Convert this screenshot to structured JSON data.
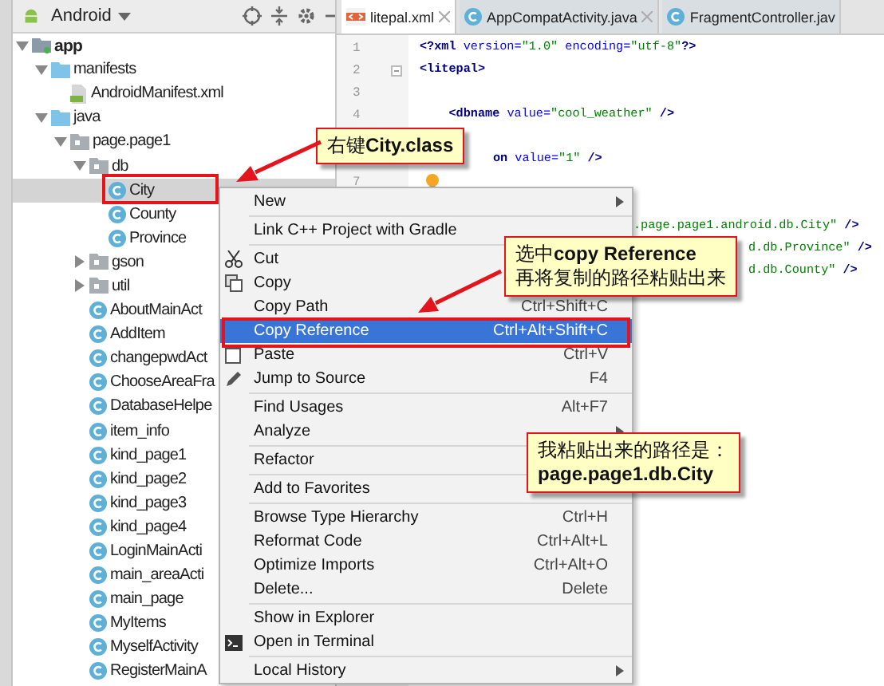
{
  "project_panel": {
    "view_selector": "Android",
    "tree": [
      {
        "label": "app",
        "kind": "module",
        "expanded": true,
        "selected": false,
        "children": [
          {
            "label": "manifests",
            "kind": "source_folder",
            "expanded": true,
            "selected": false,
            "children": [
              {
                "label": "AndroidManifest.xml",
                "kind": "manifest",
                "selected": false
              }
            ]
          },
          {
            "label": "java",
            "kind": "source_folder",
            "expanded": true,
            "selected": false,
            "children": [
              {
                "label": "page.page1",
                "kind": "package",
                "expanded": true,
                "selected": false,
                "children": [
                  {
                    "label": "db",
                    "kind": "package",
                    "expanded": true,
                    "selected": false,
                    "children": [
                      {
                        "label": "City",
                        "kind": "class",
                        "selected": true
                      },
                      {
                        "label": "County",
                        "kind": "class",
                        "selected": false
                      },
                      {
                        "label": "Province",
                        "kind": "class",
                        "selected": false
                      }
                    ]
                  },
                  {
                    "label": "gson",
                    "kind": "package",
                    "expanded": false,
                    "selected": false
                  },
                  {
                    "label": "util",
                    "kind": "package",
                    "expanded": false,
                    "selected": false
                  },
                  {
                    "label": "AboutMainAct",
                    "kind": "class",
                    "selected": false
                  },
                  {
                    "label": "AddItem",
                    "kind": "class",
                    "selected": false
                  },
                  {
                    "label": "changepwdAct",
                    "kind": "class",
                    "selected": false
                  },
                  {
                    "label": "ChooseAreaFra",
                    "kind": "class",
                    "selected": false
                  },
                  {
                    "label": "DatabaseHelpe",
                    "kind": "class",
                    "selected": false
                  },
                  {
                    "label": "item_info",
                    "kind": "class",
                    "selected": false
                  },
                  {
                    "label": "kind_page1",
                    "kind": "class",
                    "selected": false
                  },
                  {
                    "label": "kind_page2",
                    "kind": "class",
                    "selected": false
                  },
                  {
                    "label": "kind_page3",
                    "kind": "class",
                    "selected": false
                  },
                  {
                    "label": "kind_page4",
                    "kind": "class",
                    "selected": false
                  },
                  {
                    "label": "LoginMainActi",
                    "kind": "class",
                    "selected": false
                  },
                  {
                    "label": "main_areaActi",
                    "kind": "class",
                    "selected": false
                  },
                  {
                    "label": "main_page",
                    "kind": "class",
                    "selected": false
                  },
                  {
                    "label": "MyItems",
                    "kind": "class",
                    "selected": false
                  },
                  {
                    "label": "MyselfActivity",
                    "kind": "class",
                    "selected": false
                  },
                  {
                    "label": "RegisterMainA",
                    "kind": "class",
                    "selected": false
                  }
                ]
              }
            ]
          }
        ]
      }
    ]
  },
  "editor": {
    "tabs": [
      {
        "label": "litepal.xml",
        "kind": "xml",
        "selected": true,
        "closable": true
      },
      {
        "label": "AppCompatActivity.java",
        "kind": "class",
        "selected": false,
        "closable": true
      },
      {
        "label": "FragmentController.jav",
        "kind": "class",
        "selected": false,
        "closable": false
      }
    ],
    "lines": [
      {
        "kind": "code",
        "number": "1",
        "tokens": [
          {
            "text": "<?xml ",
            "kind": "tag"
          },
          {
            "text": "version=",
            "kind": "attr"
          },
          {
            "text": "\"1.0\" ",
            "kind": "value"
          },
          {
            "text": "encoding=",
            "kind": "attr"
          },
          {
            "text": "\"utf-8\"",
            "kind": "value"
          },
          {
            "text": "?>",
            "kind": "tag"
          }
        ]
      },
      {
        "kind": "code",
        "number": "2",
        "fold": true,
        "tokens": [
          {
            "text": "<litepal>",
            "kind": "tag"
          }
        ]
      },
      {
        "kind": "code",
        "number": "3"
      },
      {
        "kind": "code",
        "number": "4",
        "tokens": [
          {
            "text": "    <dbname ",
            "kind": "tag"
          },
          {
            "text": "value=",
            "kind": "attr"
          },
          {
            "text": "\"cool_weather\"",
            "kind": "value"
          },
          {
            "text": " />",
            "kind": "tag"
          }
        ]
      },
      {
        "kind": "hidden"
      },
      {
        "kind": "covered",
        "tokens": [
          {
            "text": "on ",
            "kind": "tag"
          },
          {
            "text": "value=",
            "kind": "attr"
          },
          {
            "text": "\"1\"",
            "kind": "value"
          },
          {
            "text": " />",
            "kind": "tag"
          }
        ]
      },
      {
        "kind": "code",
        "number": "7",
        "bulb": true
      },
      {
        "kind": "hidden"
      },
      {
        "kind": "tail",
        "tokens": [
          {
            "text": ".page.page1.android.db.City\"",
            "kind": "value"
          },
          {
            "text": " />",
            "kind": "tag"
          }
        ]
      },
      {
        "kind": "far_tail",
        "tokens": [
          {
            "text": "d.db.Province\"",
            "kind": "value"
          },
          {
            "text": " />",
            "kind": "tag"
          }
        ]
      },
      {
        "kind": "far_tail",
        "tokens": [
          {
            "text": "d.db.County\"",
            "kind": "value"
          },
          {
            "text": " />",
            "kind": "tag"
          }
        ]
      }
    ]
  },
  "context_menu": {
    "items": [
      {
        "label": "New",
        "submenu": true,
        "selected": false,
        "separator_after": true
      },
      {
        "label": "Link C++ Project with Gradle",
        "selected": false,
        "separator_after": true
      },
      {
        "label": "Cut",
        "selected": false
      },
      {
        "label": "Copy",
        "selected": false
      },
      {
        "label": "Copy Path",
        "shortcut": "Ctrl+Shift+C",
        "selected": false
      },
      {
        "label": "Copy Reference",
        "shortcut": "Ctrl+Alt+Shift+C",
        "selected": true
      },
      {
        "label": "Paste",
        "shortcut": "Ctrl+V",
        "selected": false
      },
      {
        "label": "Jump to Source",
        "shortcut": "F4",
        "selected": false,
        "separator_after": true
      },
      {
        "label": "Find Usages",
        "shortcut": "Alt+F7",
        "selected": false
      },
      {
        "label": "Analyze",
        "submenu": true,
        "selected": false,
        "separator_after": true
      },
      {
        "label": "Refactor",
        "selected": false,
        "separator_after": true
      },
      {
        "label": "Add to Favorites",
        "selected": false,
        "separator_after": true
      },
      {
        "label": "Browse Type Hierarchy",
        "shortcut": "Ctrl+H",
        "selected": false
      },
      {
        "label": "Reformat Code",
        "shortcut": "Ctrl+Alt+L",
        "selected": false
      },
      {
        "label": "Optimize Imports",
        "shortcut": "Ctrl+Alt+O",
        "selected": false
      },
      {
        "label": "Delete...",
        "shortcut": "Delete",
        "selected": false,
        "separator_after": true
      },
      {
        "label": "Show in Explorer",
        "selected": false
      },
      {
        "label": "Open in Terminal",
        "selected": false,
        "separator_after": true
      },
      {
        "label": "Local History",
        "submenu": true,
        "selected": false
      }
    ]
  },
  "callouts": [
    {
      "lines": [
        "右键**City.class**"
      ]
    },
    {
      "lines": [
        "选中**copy Reference**",
        "再将复制的路径粘贴出来"
      ]
    },
    {
      "lines": [
        "我粘贴出来的路径是：",
        "**page.page1.db.City**"
      ]
    }
  ]
}
